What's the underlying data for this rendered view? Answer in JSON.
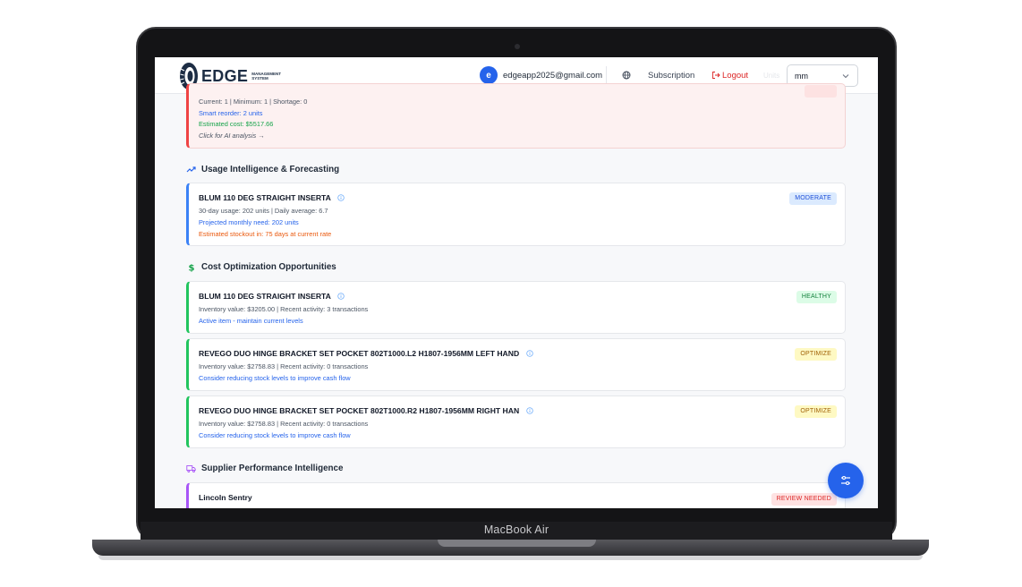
{
  "device": {
    "label": "MacBook Air"
  },
  "header": {
    "brand": "EDGE",
    "brand_sub": "MANAGEMENT SYSTEM",
    "avatar_letter": "e",
    "email": "edgeapp2025@gmail.com",
    "subscription_label": "Subscription",
    "logout_label": "Logout",
    "faint_label": "Units",
    "unit_select_value": "mm"
  },
  "top_card": {
    "line1": "Current: 1 | Minimum: 1 | Shortage: 0",
    "line2": "Smart reorder: 2 units",
    "line3": "Estimated cost: $5517.66",
    "line4": "Click for AI analysis →"
  },
  "usage_section": {
    "title": "Usage Intelligence & Forecasting",
    "card": {
      "title": "BLUM 110 DEG STRAIGHT INSERTA",
      "line1": "30-day usage: 202 units | Daily average: 6.7",
      "line2": "Projected monthly need: 202 units",
      "line3": "Estimated stockout in: 75 days at current rate",
      "badge": "MODERATE"
    }
  },
  "cost_section": {
    "title": "Cost Optimization Opportunities",
    "cards": [
      {
        "title": "BLUM 110 DEG STRAIGHT INSERTA",
        "line1": "Inventory value: $3205.00 | Recent activity: 3 transactions",
        "line2": "Active item - maintain current levels",
        "badge": "HEALTHY"
      },
      {
        "title": "REVEGO DUO HINGE BRACKET SET POCKET 802T1000.L2 H1807-1956MM LEFT HAND",
        "line1": "Inventory value: $2758.83 | Recent activity: 0 transactions",
        "line2": "Consider reducing stock levels to improve cash flow",
        "badge": "OPTIMIZE"
      },
      {
        "title": "REVEGO DUO HINGE BRACKET SET POCKET 802T1000.R2 H1807-1956MM RIGHT HAN",
        "line1": "Inventory value: $2758.83 | Recent activity: 0 transactions",
        "line2": "Consider reducing stock levels to improve cash flow",
        "badge": "OPTIMIZE"
      }
    ]
  },
  "supplier_section": {
    "title": "Supplier Performance Intelligence",
    "card": {
      "title": "Lincoln Sentry",
      "badge": "REVIEW NEEDED"
    }
  },
  "colors": {
    "accent": "#2563eb",
    "danger": "#dc2626",
    "success": "#16a34a",
    "warning": "#ea580c"
  },
  "icons": {
    "trend": "trending-up-icon",
    "dollar": "dollar-icon",
    "truck": "truck-icon",
    "info": "info-icon",
    "globe": "globe-icon",
    "logout": "logout-icon",
    "fab": "sliders-icon"
  }
}
